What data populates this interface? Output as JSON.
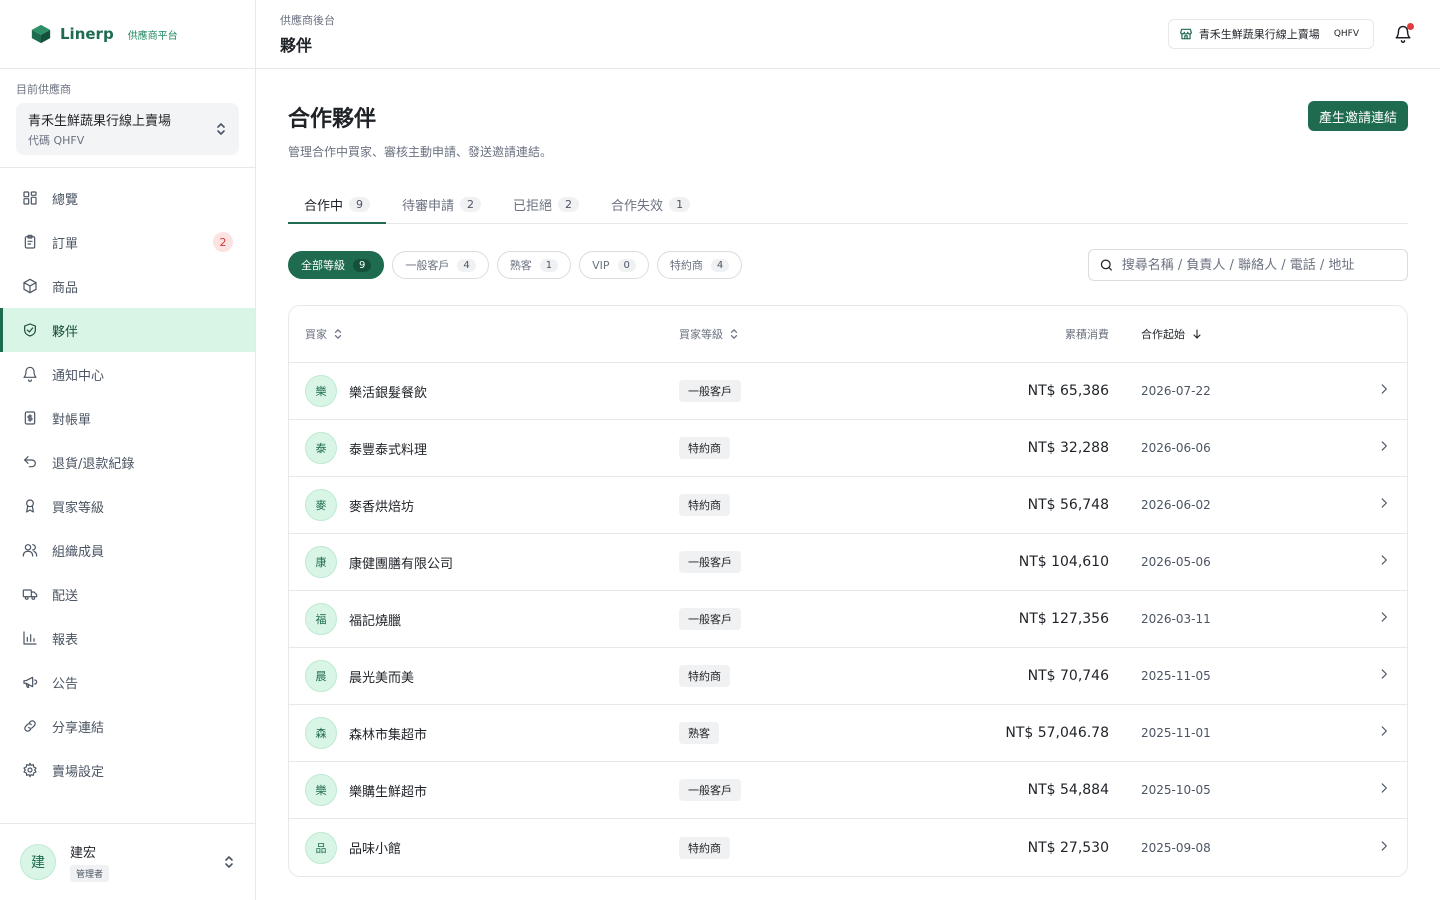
{
  "brand": {
    "name": "Linerp",
    "sub": "供應商平台"
  },
  "vendor": {
    "caption": "目前供應商",
    "name": "青禾生鮮蔬果行線上賣場",
    "code": "代碼 QHFV"
  },
  "nav": [
    {
      "label": "總覽",
      "icon": "grid-icon",
      "name": "sidebar-item-overview"
    },
    {
      "label": "訂單",
      "icon": "clipboard-icon",
      "name": "sidebar-item-orders",
      "badge": "2"
    },
    {
      "label": "商品",
      "icon": "box-icon",
      "name": "sidebar-item-products"
    },
    {
      "label": "夥伴",
      "icon": "handshake-icon",
      "name": "sidebar-item-partners",
      "active": true
    },
    {
      "label": "通知中心",
      "icon": "bell-icon",
      "name": "sidebar-item-notifications"
    },
    {
      "label": "對帳單",
      "icon": "invoice-icon",
      "name": "sidebar-item-statements"
    },
    {
      "label": "退貨/退款紀錄",
      "icon": "return-icon",
      "name": "sidebar-item-returns"
    },
    {
      "label": "買家等級",
      "icon": "award-icon",
      "name": "sidebar-item-buyer-levels"
    },
    {
      "label": "組織成員",
      "icon": "users-icon",
      "name": "sidebar-item-members"
    },
    {
      "label": "配送",
      "icon": "truck-icon",
      "name": "sidebar-item-delivery"
    },
    {
      "label": "報表",
      "icon": "bar-chart-icon",
      "name": "sidebar-item-reports"
    },
    {
      "label": "公告",
      "icon": "megaphone-icon",
      "name": "sidebar-item-announcements"
    },
    {
      "label": "分享連結",
      "icon": "link-icon",
      "name": "sidebar-item-share-links"
    },
    {
      "label": "賣場設定",
      "icon": "gear-icon",
      "name": "sidebar-item-settings"
    }
  ],
  "user": {
    "initial": "建",
    "name": "建宏",
    "role": "管理者"
  },
  "topbar": {
    "crumb": "供應商後台",
    "title": "夥伴",
    "store_name": "青禾生鮮蔬果行線上賣場",
    "store_code": "QHFV"
  },
  "page": {
    "title": "合作夥伴",
    "subtitle": "管理合作中買家、審核主動申請、發送邀請連結。",
    "invite_button": "產生邀請連結"
  },
  "tabs": [
    {
      "label": "合作中",
      "count": "9",
      "active": true
    },
    {
      "label": "待審申請",
      "count": "2"
    },
    {
      "label": "已拒絕",
      "count": "2"
    },
    {
      "label": "合作失效",
      "count": "1"
    }
  ],
  "level_filters": [
    {
      "label": "全部等級",
      "count": "9",
      "active": true
    },
    {
      "label": "一般客戶",
      "count": "4"
    },
    {
      "label": "熟客",
      "count": "1"
    },
    {
      "label": "VIP",
      "count": "0"
    },
    {
      "label": "特約商",
      "count": "4"
    }
  ],
  "search": {
    "placeholder": "搜尋名稱 / 負責人 / 聯絡人 / 電話 / 地址"
  },
  "table": {
    "headers": {
      "buyer": "買家",
      "level": "買家等級",
      "amount": "累積消費",
      "since": "合作起始"
    },
    "rows": [
      {
        "initial": "樂",
        "name": "樂活銀髮餐飲",
        "level": "一般客戶",
        "amount": "NT$ 65,386",
        "since": "2026-07-22"
      },
      {
        "initial": "泰",
        "name": "泰豐泰式料理",
        "level": "特約商",
        "amount": "NT$ 32,288",
        "since": "2026-06-06"
      },
      {
        "initial": "麥",
        "name": "麥香烘焙坊",
        "level": "特約商",
        "amount": "NT$ 56,748",
        "since": "2026-06-02"
      },
      {
        "initial": "康",
        "name": "康健團膳有限公司",
        "level": "一般客戶",
        "amount": "NT$ 104,610",
        "since": "2026-05-06"
      },
      {
        "initial": "福",
        "name": "福記燒臘",
        "level": "一般客戶",
        "amount": "NT$ 127,356",
        "since": "2026-03-11"
      },
      {
        "initial": "晨",
        "name": "晨光美而美",
        "level": "特約商",
        "amount": "NT$ 70,746",
        "since": "2025-11-05"
      },
      {
        "initial": "森",
        "name": "森林市集超市",
        "level": "熟客",
        "amount": "NT$ 57,046.78",
        "since": "2025-11-01"
      },
      {
        "initial": "樂",
        "name": "樂購生鮮超市",
        "level": "一般客戶",
        "amount": "NT$ 54,884",
        "since": "2025-10-05"
      },
      {
        "initial": "品",
        "name": "品味小館",
        "level": "特約商",
        "amount": "NT$ 27,530",
        "since": "2025-09-08"
      }
    ]
  },
  "colors": {
    "brand": "#1e6b4f",
    "active_nav_bg": "#d9f5e6",
    "badge_red": "#d33a3a"
  }
}
